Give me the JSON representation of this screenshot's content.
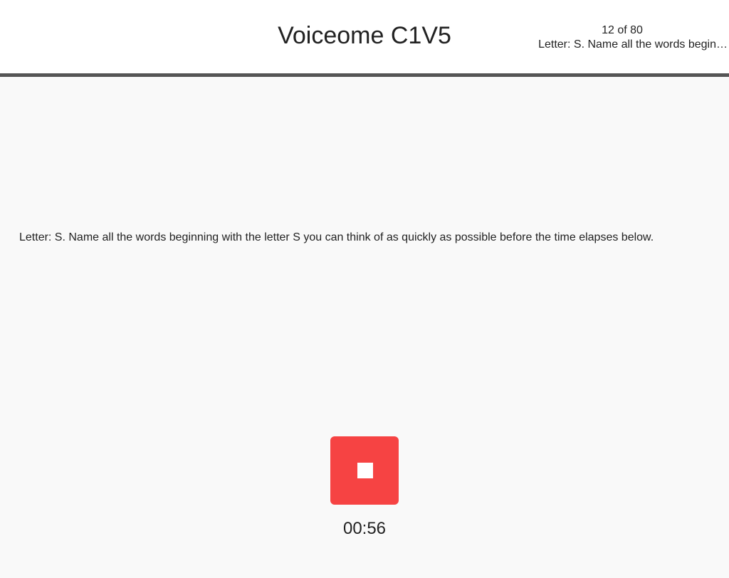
{
  "header": {
    "title": "Voiceome C1V5",
    "progress": "12 of 80",
    "prompt_preview": "Letter: S. Name all the words begin…"
  },
  "task": {
    "instructions": "Letter: S. Name all the words beginning with the letter S you can think of as quickly as possible before the time elapses below."
  },
  "recorder": {
    "stop_icon": "stop-icon",
    "button_color": "#f64343",
    "timer": "00:56"
  }
}
